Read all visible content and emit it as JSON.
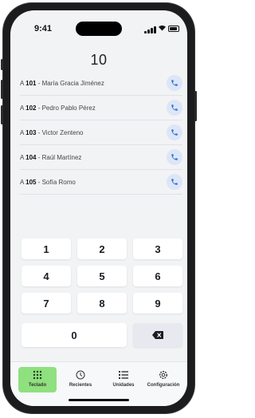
{
  "status_bar": {
    "time": "9:41"
  },
  "dialer": {
    "number": "10"
  },
  "contacts": [
    {
      "prefix": "A ",
      "code": "101",
      "name": " - María Gracia Jiménez"
    },
    {
      "prefix": "A ",
      "code": "102",
      "name": " - Pedro Pablo Pérez"
    },
    {
      "prefix": "A ",
      "code": "103",
      "name": " - Victor Zenteno"
    },
    {
      "prefix": "A ",
      "code": "104",
      "name": " - Raúl Martínez"
    },
    {
      "prefix": "A ",
      "code": "105",
      "name": " - Sofía Romo"
    }
  ],
  "keypad": {
    "keys": [
      "1",
      "2",
      "3",
      "4",
      "5",
      "6",
      "7",
      "8",
      "9"
    ],
    "zero": "0"
  },
  "tabs": [
    {
      "label": "Teclado",
      "icon": "keypad-icon",
      "active": true
    },
    {
      "label": "Recientes",
      "icon": "clock-icon",
      "active": false
    },
    {
      "label": "Unidades",
      "icon": "list-icon",
      "active": false
    },
    {
      "label": "Configuración",
      "icon": "gear-icon",
      "active": false
    }
  ],
  "colors": {
    "accent_green": "#8fe07e",
    "call_button_bg": "#dde6f7",
    "call_icon": "#2f6fdc",
    "screen_bg": "#f2f3f5"
  }
}
